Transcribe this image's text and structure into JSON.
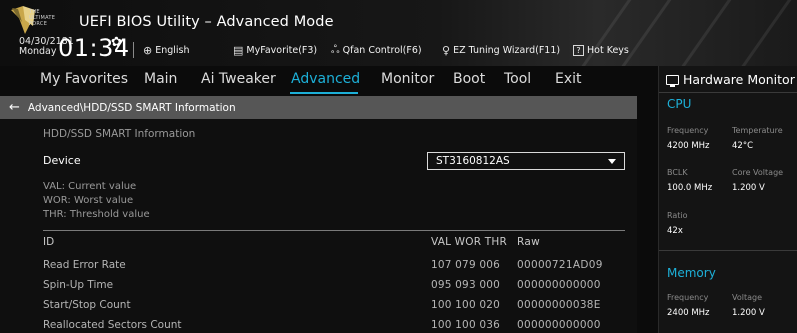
{
  "header": {
    "logo_text": [
      "THE",
      "ULTIMATE",
      "FORCE"
    ],
    "title": "UEFI BIOS Utility – Advanced Mode",
    "date": "04/30/2181",
    "day": "Monday",
    "time": "01:34",
    "buttons": {
      "language": "English",
      "myfavorite": "MyFavorite(F3)",
      "qfan": "Qfan Control(F6)",
      "ez_tuning": "EZ Tuning Wizard(F11)",
      "hotkeys": "Hot Keys",
      "hotkeys_key": "?"
    }
  },
  "nav": {
    "items": [
      "My Favorites",
      "Main",
      "Ai Tweaker",
      "Advanced",
      "Monitor",
      "Boot",
      "Tool",
      "Exit"
    ],
    "active": "Advanced"
  },
  "breadcrumb": "Advanced\\HDD/SSD SMART Information",
  "main": {
    "section_title": "HDD/SSD SMART Information",
    "device_label": "Device",
    "device_value": "ST3160812AS",
    "legend": [
      "VAL:  Current value",
      "WOR:  Worst value",
      "THR:  Threshold value"
    ],
    "table": {
      "header": {
        "id": "ID",
        "vals": "VAL WOR THR",
        "raw": "Raw"
      },
      "rows": [
        {
          "id": "Read Error Rate",
          "vals": "107  079  006",
          "raw": "00000721AD09"
        },
        {
          "id": "Spin-Up Time",
          "vals": "095  093  000",
          "raw": "000000000000"
        },
        {
          "id": "Start/Stop Count",
          "vals": "100  100  020",
          "raw": "00000000038E"
        },
        {
          "id": "Reallocated Sectors Count",
          "vals": "100  100  036",
          "raw": "000000000000"
        }
      ]
    }
  },
  "hardware_monitor": {
    "title": "Hardware Monitor",
    "cpu": {
      "title": "CPU",
      "frequency_label": "Frequency",
      "frequency": "4200 MHz",
      "temperature_label": "Temperature",
      "temperature": "42°C",
      "bclk_label": "BCLK",
      "bclk": "100.0 MHz",
      "core_voltage_label": "Core Voltage",
      "core_voltage": "1.200 V",
      "ratio_label": "Ratio",
      "ratio": "42x"
    },
    "memory": {
      "title": "Memory",
      "frequency_label": "Frequency",
      "frequency": "2400 MHz",
      "voltage_label": "Voltage",
      "voltage": "1.200 V"
    }
  },
  "colors": {
    "accent": "#1db0d8",
    "breadcrumb_bg": "#565656",
    "background": "#0b0b0b"
  }
}
